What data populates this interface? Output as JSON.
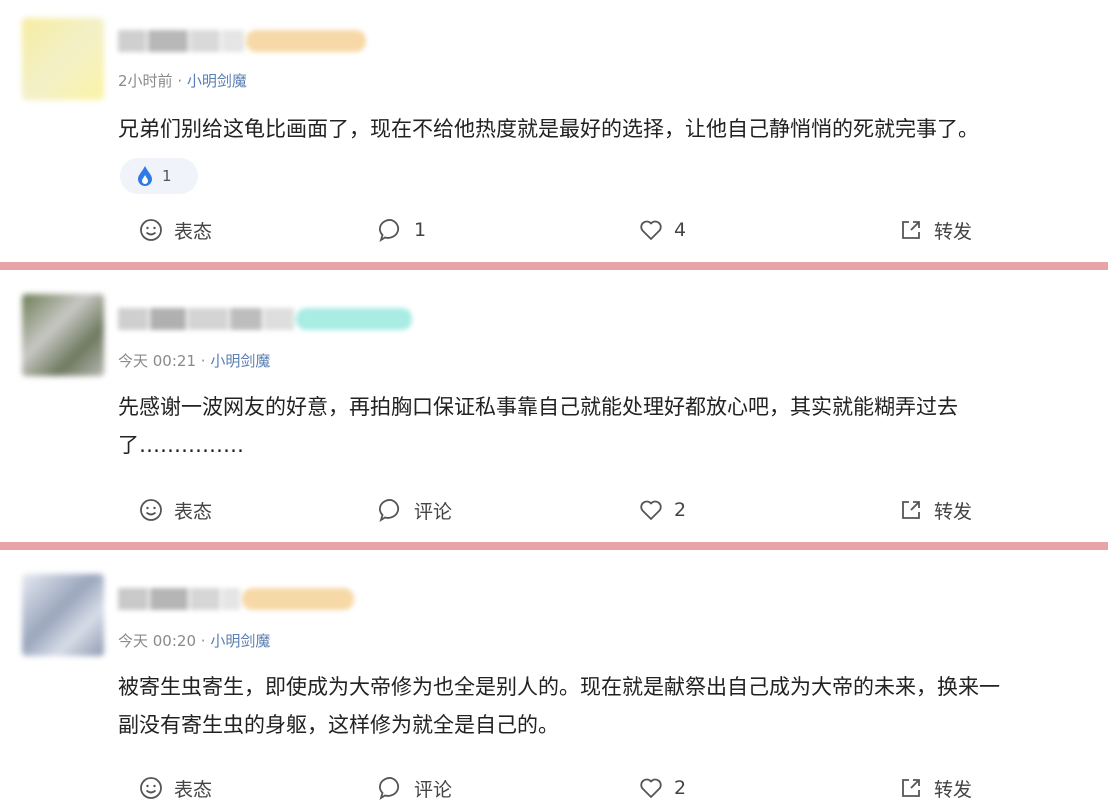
{
  "comments": [
    {
      "time": "2小时前",
      "dot": "·",
      "source": "小明剑魔",
      "text": "兄弟们别给这龟比画面了，现在不给他热度就是最好的选择，让他自己静悄悄的死就完事了。",
      "reaction_count": "1",
      "actions": {
        "react_label": "表态",
        "comment_label": "1",
        "like_label": "4",
        "share_label": "转发"
      }
    },
    {
      "time": "今天 00:21",
      "dot": "·",
      "source": "小明剑魔",
      "text_line1": "先感谢一波网友的好意，再拍胸口保证私事靠自己就能处理好都放心吧，其实就能糊弄过去",
      "text_line2": "了……………",
      "actions": {
        "react_label": "表态",
        "comment_label": "评论",
        "like_label": "2",
        "share_label": "转发"
      }
    },
    {
      "time": "今天 00:20",
      "dot": "·",
      "source": "小明剑魔",
      "text_line1": "被寄生虫寄生，即使成为大帝修为也全是别人的。现在就是献祭出自己成为大帝的未来，换来一",
      "text_line2": "副没有寄生虫的身躯，这样修为就全是自己的。",
      "actions": {
        "react_label": "表态",
        "comment_label": "评论",
        "like_label": "2",
        "share_label": "转发"
      }
    }
  ],
  "colors": {
    "divider": "#e8a3a6",
    "source_link": "#5a7fb3",
    "reaction_bg": "#f0f3f9",
    "icon": "#555555"
  }
}
